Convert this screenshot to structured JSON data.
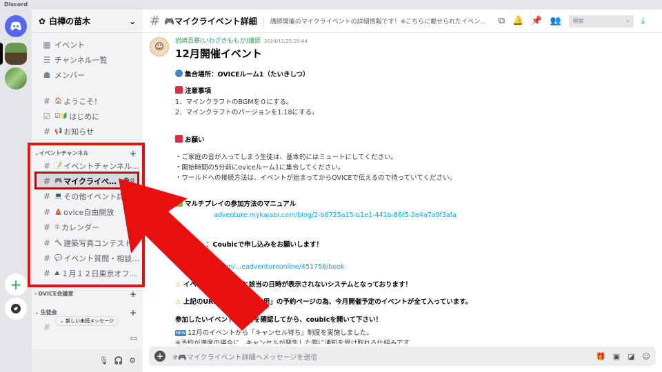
{
  "app": {
    "title": "Discord"
  },
  "colors": {
    "accent_red": "#e8100e",
    "link": "#00a8fc",
    "author": "#2c9f58"
  },
  "server": {
    "name": "白樺の苗木"
  },
  "channels": {
    "top": [
      {
        "label": "イベント",
        "icon": "calendar-icon"
      },
      {
        "label": "チャンネル一覧",
        "icon": "list-icon"
      },
      {
        "label": "メンバー",
        "icon": "members-icon"
      }
    ],
    "welcome": [
      {
        "emoji": "🏠",
        "label": "ようこそ！"
      },
      {
        "emoji": "☑🔰",
        "label": "はじめに"
      },
      {
        "emoji": "📢",
        "label": "お知らせ"
      }
    ],
    "event_category": "イベントチャンネル",
    "event_channels": [
      {
        "emoji": "📝",
        "label": "イベントチャンネル…"
      },
      {
        "emoji": "🎮",
        "label": "マイクライベ…"
      },
      {
        "emoji": "💻",
        "label": "その他イベント詳"
      },
      {
        "emoji": "🛕",
        "label": "ovice自由開放"
      },
      {
        "emoji": "①",
        "label": "カレンダー"
      },
      {
        "emoji": "🔨",
        "label": "建築写真コンテスト"
      },
      {
        "emoji": "💬",
        "label": "イベント質問・相談…"
      },
      {
        "emoji": "⛰",
        "label": "１月１２日東京オフ…"
      }
    ],
    "cat2": "OVICE会議室",
    "cat3": "生徒会",
    "new_unread": "新しい未読メッセージ"
  },
  "header": {
    "hash": "#",
    "title": "🎮マイクライベント詳細",
    "topic": "講師開催のマイクライベントの詳細情報です！※こちらに載せられたイベント…",
    "search_placeholder": "検索"
  },
  "message": {
    "author": "岩崎百華(いわざきももか)講師",
    "timestamp": "2024/11/25 20:44",
    "heading": "12月開催イベント",
    "place": "集合場所：OVICEルーム1（たいきしつ）",
    "notes_title": "注意事項",
    "note1": "1．マインクラフトのBGMを０にする。",
    "note2": "2．マインクラフトのバージョンを1.18にする。",
    "request_title": "お願い",
    "req1": "・ご家庭の音が入ってしまう生徒は、基本的にはミュートにしてください。",
    "req2": "・開始時間の5分前にoviceルーム1に集合してください。",
    "req3": "・ワールドへの接続方法は、イベントが始まってからOVICEで伝えるので待っていてください。",
    "manual_title": "マルチプレイの参加方法のマニュアル",
    "manual_link": "adventure.mykajabi.com/blog/2-b6725a15-b1e1-441b-86f5-2e4a7a9f3afa",
    "apply_title": "：Coubicで申し込みをお願いします！",
    "apply_sub": "：int",
    "apply_link": "tps://coubic.com/…eadventureonline/451756/book",
    "warn1": "イベントの予約カ…と該当の日時が表示されないシステムとなっております！",
    "warn2": "上記のURL先は「イベント用」の予約ページの為、今月開催予定のイベントが全て入っています。",
    "check": "参加したいイベントの日時を確認してから、coubicを開いて下さい！",
    "new_badge": "NEW",
    "newline": "12月のイベントから「キャンセル待ち」制度を実施しました。",
    "cut": "※予約が満席の場合に、キャンセルが発生した際に通知を受け取れる仕組みです"
  },
  "input": {
    "placeholder": "#🎮マイクライベント詳細へメッセージを送信"
  }
}
